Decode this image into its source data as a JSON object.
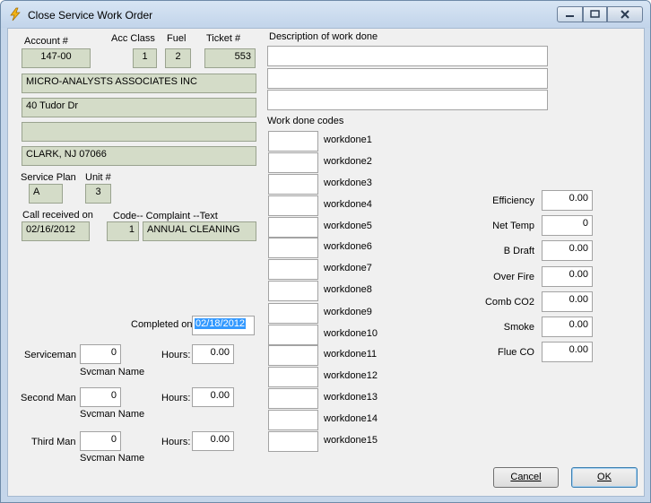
{
  "window": {
    "title": "Close Service Work Order"
  },
  "account": {
    "account_label": "Account #",
    "account_value": "147-00",
    "acc_class_label": "Acc Class",
    "acc_class_value": "1",
    "fuel_label": "Fuel",
    "fuel_value": "2",
    "ticket_label": "Ticket #",
    "ticket_value": "553"
  },
  "address": {
    "name": "MICRO-ANALYSTS ASSOCIATES INC",
    "street": "40 Tudor Dr",
    "line3": "",
    "city": "CLARK,  NJ  07066"
  },
  "service": {
    "plan_label": "Service Plan",
    "plan_value": "A",
    "unit_label": "Unit #",
    "unit_value": "3",
    "call_label": "Call received on",
    "call_value": "02/16/2012",
    "code_label": "Code-- Complaint --Text",
    "code_value": "1",
    "complaint_value": "ANNUAL CLEANING"
  },
  "completed": {
    "label": "Completed on",
    "value": "02/18/2012"
  },
  "crew": {
    "hours_label": "Hours:",
    "svcman_name_label": "Svcman Name",
    "rows": [
      {
        "label": "Serviceman",
        "id": "0",
        "hours": "0.00"
      },
      {
        "label": "Second Man",
        "id": "0",
        "hours": "0.00"
      },
      {
        "label": "Third Man",
        "id": "0",
        "hours": "0.00"
      }
    ]
  },
  "description": {
    "label": "Description of work done",
    "line1": "",
    "line2": "",
    "line3": ""
  },
  "work_codes": {
    "label": "Work done codes",
    "items": [
      "workdone1",
      "workdone2",
      "workdone3",
      "workdone4",
      "workdone5",
      "workdone6",
      "workdone7",
      "workdone8",
      "workdone9",
      "workdone10",
      "workdone11",
      "workdone12",
      "workdone13",
      "workdone14",
      "workdone15"
    ]
  },
  "readings": [
    {
      "label": "Efficiency",
      "value": "0.00"
    },
    {
      "label": "Net Temp",
      "value": "0"
    },
    {
      "label": "B Draft",
      "value": "0.00"
    },
    {
      "label": "Over Fire",
      "value": "0.00"
    },
    {
      "label": "Comb CO2",
      "value": "0.00"
    },
    {
      "label": "Smoke",
      "value": "0.00"
    },
    {
      "label": "Flue CO",
      "value": "0.00"
    }
  ],
  "buttons": {
    "cancel": "Cancel",
    "ok": "OK"
  }
}
